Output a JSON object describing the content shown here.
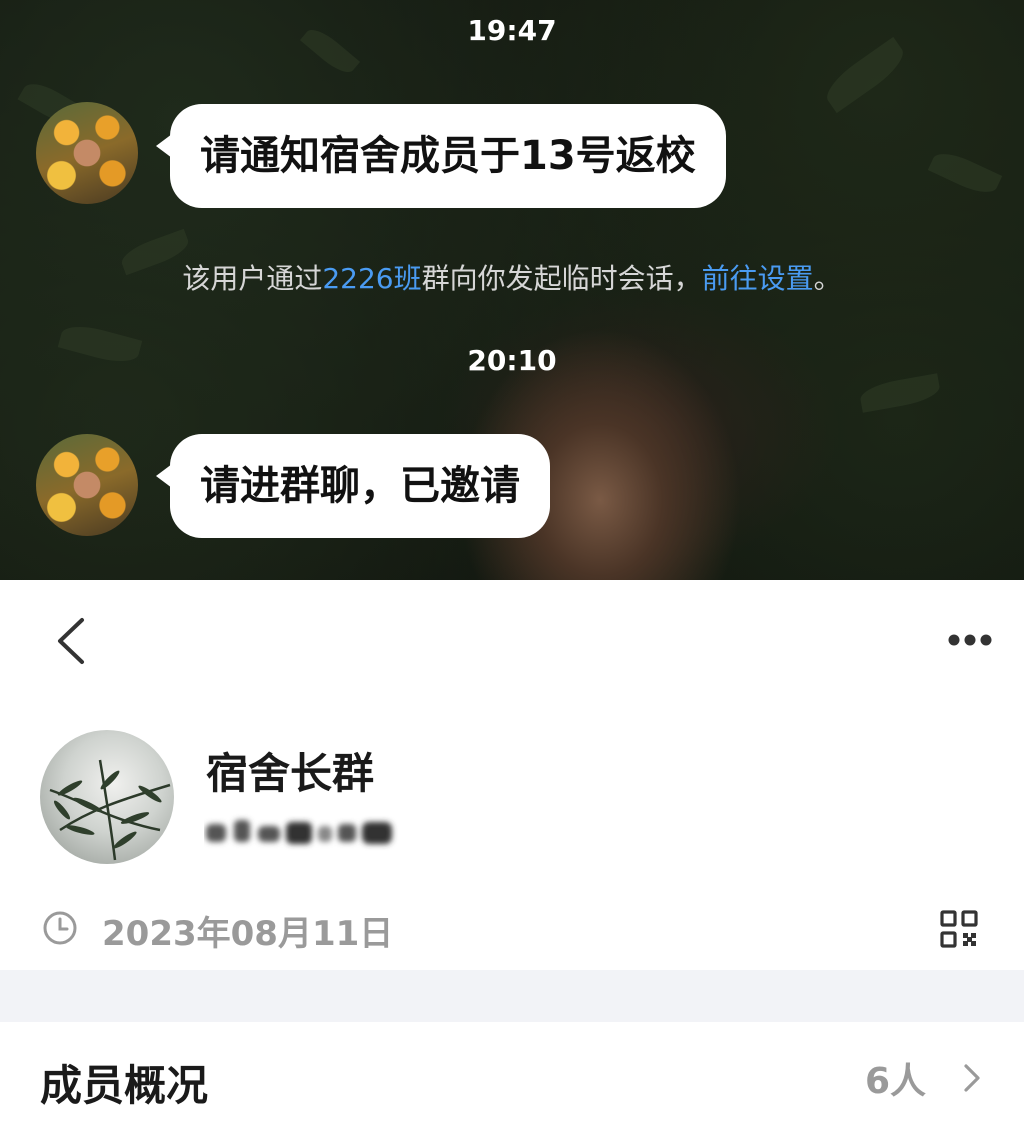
{
  "chat": {
    "time_1": "19:47",
    "message_1": "请通知宿舍成员于13号返校",
    "system_note": {
      "prefix": "该用户通过",
      "group_link": "2226班",
      "middle": "群向你发起临时会话，",
      "settings_link": "前往设置",
      "suffix": "。"
    },
    "time_2": "20:10",
    "message_2": "请进群聊，已邀请"
  },
  "group": {
    "name": "宿舍长群",
    "created_date": "2023年08月11日"
  },
  "members": {
    "title": "成员概况",
    "count": "6人"
  },
  "colors": {
    "link": "#4a9bf2",
    "muted_text": "#9a9a9a",
    "band": "#f2f3f7"
  },
  "icons": {
    "back": "back-arrow-icon",
    "more": "more-dots-icon",
    "clock": "clock-icon",
    "qr": "qr-code-icon",
    "chevron": "chevron-right-icon"
  }
}
